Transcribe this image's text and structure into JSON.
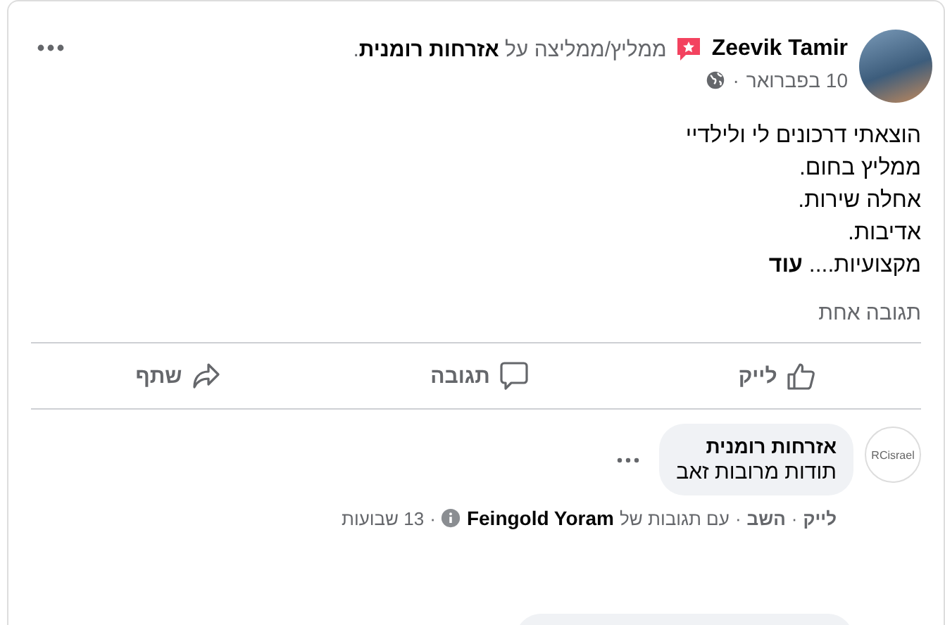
{
  "post": {
    "author": "Zeevik Tamir",
    "action": "ממליץ/ממליצה על **אזרחות רומנית**.",
    "date": "10 בפברואר",
    "separator": "·",
    "body_lines": [
      "הוצאתי דרכונים לי ולילדיי",
      "ממליץ בחום.",
      "אחלה שירות.",
      "אדיבות.",
      "מקצועיות...."
    ],
    "more_link": "עוד",
    "comment_count": "תגובה אחת"
  },
  "actions": [
    {
      "kind": "like",
      "label": "לייק"
    },
    {
      "kind": "comment",
      "label": "תגובה"
    },
    {
      "kind": "share",
      "label": "שתף"
    }
  ],
  "comment": {
    "avatar_text": "RCisrael",
    "author": "אזרחות רומנית",
    "text": "תודות מרובות זאב",
    "like": "לייק",
    "reply": "השב",
    "replied_with": "עם תגובות של",
    "replier": "Feingold Yoram",
    "time": "13 שבועות",
    "separator": "·"
  }
}
